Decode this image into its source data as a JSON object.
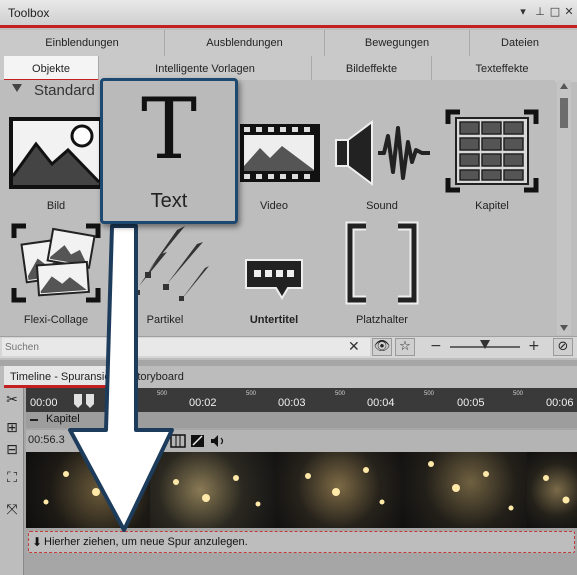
{
  "toolbox": {
    "title": "Toolbox",
    "controls": [
      "▾",
      "⊥",
      "□",
      "✕"
    ],
    "tabs_row1": [
      "Einblendungen",
      "Ausblendungen",
      "Bewegungen",
      "Dateien"
    ],
    "tabs_row2": [
      "Objekte",
      "Intelligente Vorlagen",
      "Bildeffekte",
      "Texteffekte"
    ],
    "active_tab": "Objekte",
    "group_label": "Standard",
    "tiles": [
      {
        "label": "Bild",
        "icon": "image-icon"
      },
      {
        "label": "Video",
        "icon": "film-icon"
      },
      {
        "label": "Sound",
        "icon": "speaker-icon"
      },
      {
        "label": "Kapitel",
        "icon": "chapter-icon"
      },
      {
        "label": "Flexi-Collage",
        "icon": "collage-icon"
      },
      {
        "label": "Partikel",
        "icon": "particle-icon"
      },
      {
        "label": "Untertitel",
        "icon": "subtitle-icon"
      },
      {
        "label": "Platzhalter",
        "icon": "placeholder-icon"
      }
    ],
    "search_placeholder": "Suchen",
    "clear_glyph": "✕",
    "eye_glyph": "👁",
    "star_glyph": "☆",
    "minus_glyph": "−",
    "plus_glyph": "+",
    "zoom_level": 0.5
  },
  "drag_card": {
    "glyph": "T",
    "label": "Text"
  },
  "timeline": {
    "tabs": [
      "Timeline - Spuransicht",
      "Storyboard"
    ],
    "ruler_labels": [
      "00:02",
      "00:03",
      "00:04",
      "00:05",
      "00:06"
    ],
    "ruler_small": [
      "500",
      "500",
      "500",
      "500",
      "500"
    ],
    "ruler_start": "00:00",
    "track_title": "Kapitel",
    "track_time": "00:56.3",
    "drop_text": "Hierher ziehen, um neue Spur anzulegen.",
    "drop_glyph": "⬇"
  },
  "colors": {
    "accent_red": "#c32121",
    "card_border": "#1d4870"
  }
}
